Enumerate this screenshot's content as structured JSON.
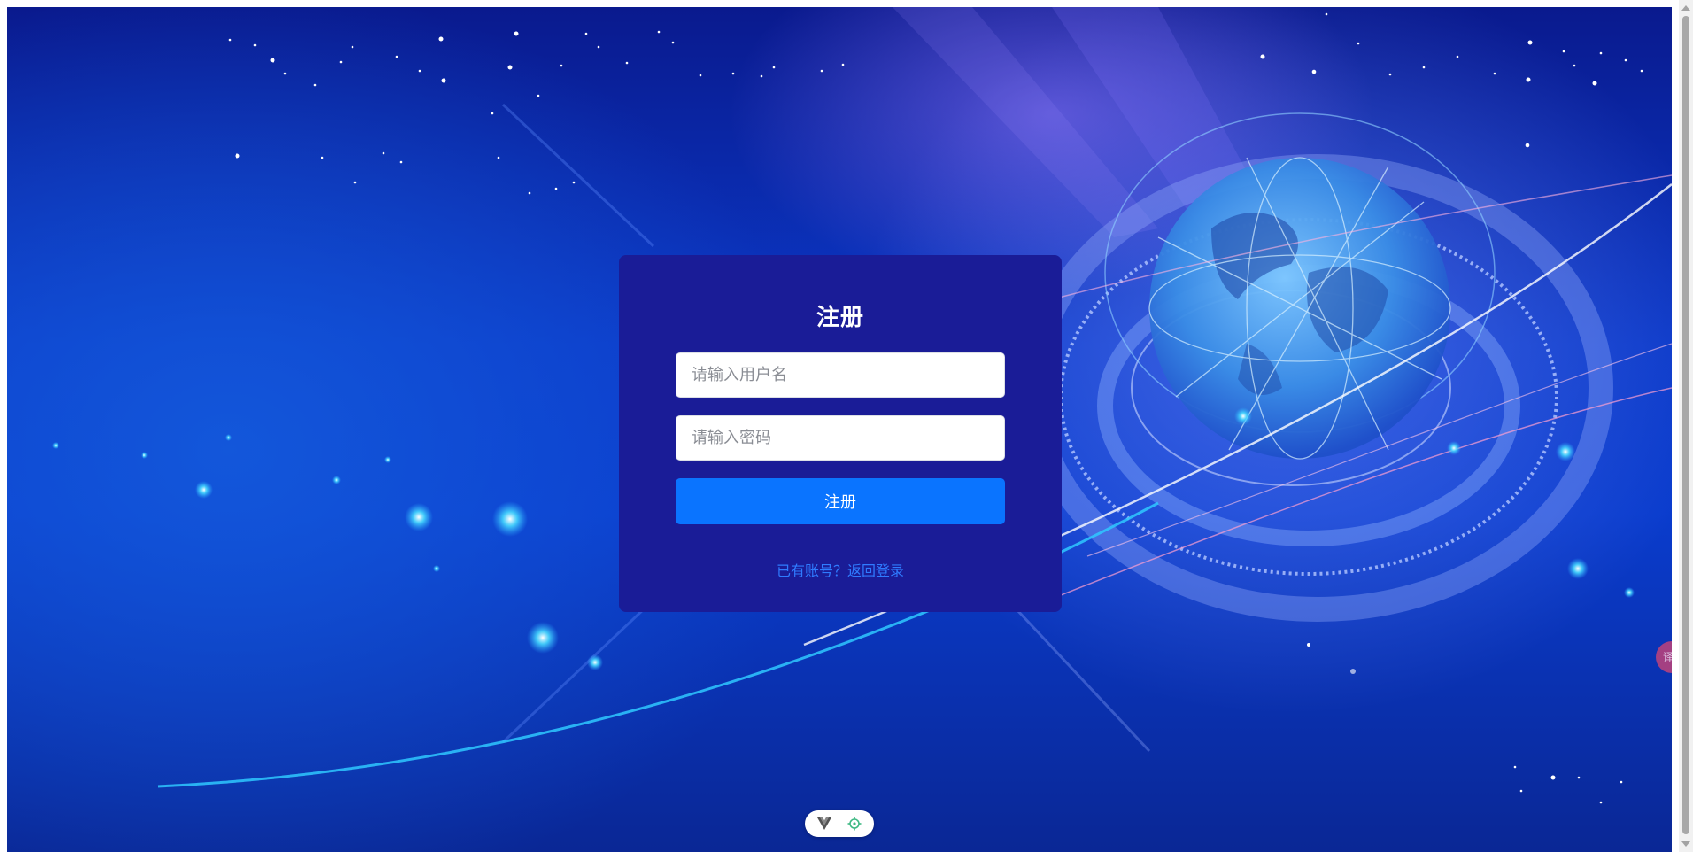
{
  "register": {
    "title": "注册",
    "username_placeholder": "请输入用户名",
    "password_placeholder": "请输入密码",
    "submit_label": "注册",
    "login_link": "已有账号？返回登录"
  },
  "translate_widget": {
    "label": "译A"
  },
  "icons": {
    "devtools": [
      "vue-logo-icon",
      "target-icon"
    ]
  },
  "colors": {
    "card": "#1a1c97",
    "button": "#0a74ff",
    "link": "#2f7bff"
  }
}
